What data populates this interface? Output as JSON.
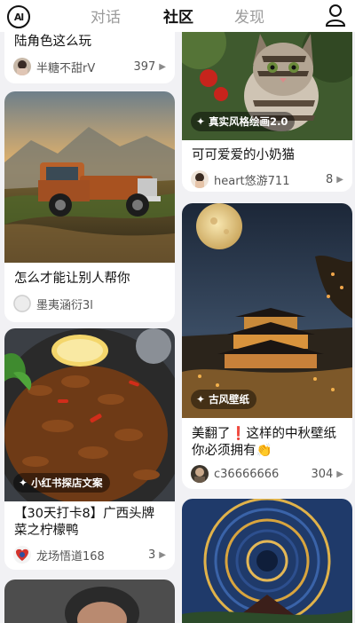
{
  "nav": {
    "tabs": [
      {
        "label": "对话",
        "active": false
      },
      {
        "label": "社区",
        "active": true
      },
      {
        "label": "发现",
        "active": false
      }
    ],
    "logo_icon": "ai-logo-icon",
    "profile_icon": "person-icon"
  },
  "feed": {
    "left": [
      {
        "title": "陆角色这么玩",
        "author": "半糖不甜rV",
        "count": "397"
      },
      {
        "title": "怎么才能让别人帮你",
        "author": "墨夷涵衍3l",
        "count": ""
      },
      {
        "title": "【30天打卡8】广西头牌菜之柠檬鸭",
        "author": "龙场悟道168",
        "count": "3",
        "badge": "小红书探店文案"
      }
    ],
    "right": [
      {
        "title": "可可爱爱的小奶猫",
        "author": "heart悠游711",
        "count": "8",
        "badge": "真实风格绘画2.0"
      },
      {
        "title": "美翻了❗这样的中秋壁纸你必须拥有👏",
        "author": "c36666666",
        "count": "304",
        "badge": "古风壁纸"
      }
    ]
  },
  "icons": {
    "spark": "✦",
    "play": "▶"
  }
}
